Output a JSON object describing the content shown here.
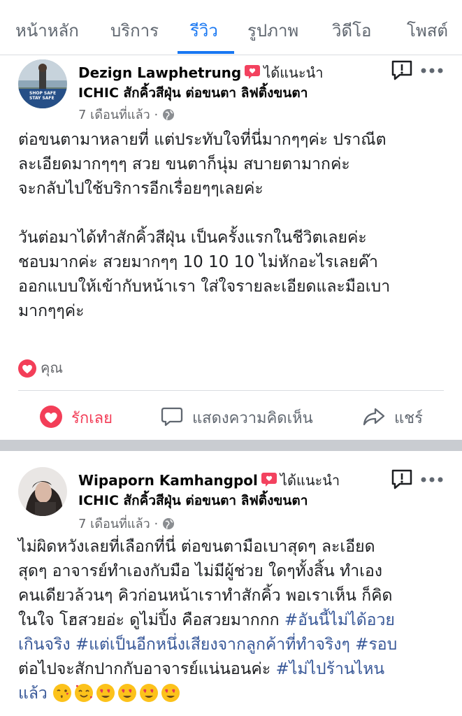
{
  "tabs": [
    {
      "label": "หน้าหลัก",
      "active": false
    },
    {
      "label": "บริการ",
      "active": false
    },
    {
      "label": "รีวิว",
      "active": true
    },
    {
      "label": "รูปภาพ",
      "active": false
    },
    {
      "label": "วิดีโอ",
      "active": false
    },
    {
      "label": "โพสต์",
      "active": false
    }
  ],
  "colors": {
    "accent": "#1877f2",
    "love": "#f33e58",
    "recommend": "#f3425f",
    "hashtag": "#385898"
  },
  "posts": [
    {
      "author": "Dezign Lawphetrung",
      "recommend_text": "ได้แนะนำ",
      "page": "ICHIC สักคิ้วสีฝุ่น ต่อขนตา ลิฟติ้งขนตา",
      "time": "7 เดือนที่แล้ว ·",
      "avatar_badge": [
        "SHOP SAFE",
        "STAY SAFE"
      ],
      "paragraphs": [
        [
          "ต่อขนตามาหลายที่ แต่ประทับใจที่นี่มากๆๆค่ะ ปราณีต",
          "ละเอียดมากๆๆๆ สวย ขนตาก็นุ่ม สบายตามากค่ะ",
          "จะกลับไปใช้บริการอีกเรื่อยๆๆเลยค่ะ"
        ],
        [
          "วันต่อมาได้ทำสักคิ้วสีฝุ่น เป็นครั้งแรกในชีวิตเลยค่ะ",
          "ชอบมากค่ะ สวยมากๆๆ 10 10 10 ไม่หักอะไรเลยค๊า",
          "ออกแบบให้เข้ากับหน้าเรา ใส่ใจรายละเอียดและมือเบา",
          "มากๆๆค่ะ"
        ]
      ],
      "reaction_label": "คุณ",
      "actions": {
        "love": "รักเลย",
        "comment": "แสดงความคิดเห็น",
        "share": "แชร์"
      }
    },
    {
      "author": "Wipaporn Kamhangpol",
      "recommend_text": "ได้แนะนำ",
      "page": "ICHIC สักคิ้วสีฝุ่น ต่อขนตา ลิฟติ้งขนตา",
      "time": "7 เดือนที่แล้ว ·",
      "lines": [
        "ไม่ผิดหวังเลยที่เลือกที่นี่ ต่อขนตามือเบาสุดๆ ละเอียด",
        "สุดๆ อาจารย์ทำเองกับมือ ไม่มีผู้ช่วย ใดๆทั้งสิ้น ทำเอง",
        "คนเดียวล้วนๆ คิวก่อนหน้าเราทำสักคิ้ว พอเราเห็น ก็คิด"
      ],
      "line4_plain": "ในใจ โฮสวยอ่ะ ดูไม่ปิ้ง คือสวยมากกก ",
      "line4_tag": "#อันนี้ไม่ได้อวย",
      "line5_tag1": "เกินจริง",
      "line5_tag2": "#แต่เป็นอีกหนึ่งเสียงจากลูกค้าที่ทำจริงๆ",
      "line5_tag3": "#รอบ",
      "line6_plain": "ต่อไปจะสักปากกับอาจารย์แน่นอนค่ะ ",
      "line6_tag": "#ไม่ไปร้านไหน",
      "line7_tag": "แล้ว",
      "emojis": [
        "kissing-face",
        "smiling-hearts-face",
        "heart-eyes-face",
        "heart-eyes-face",
        "heart-eyes-face",
        "heart-eyes-face"
      ]
    }
  ]
}
